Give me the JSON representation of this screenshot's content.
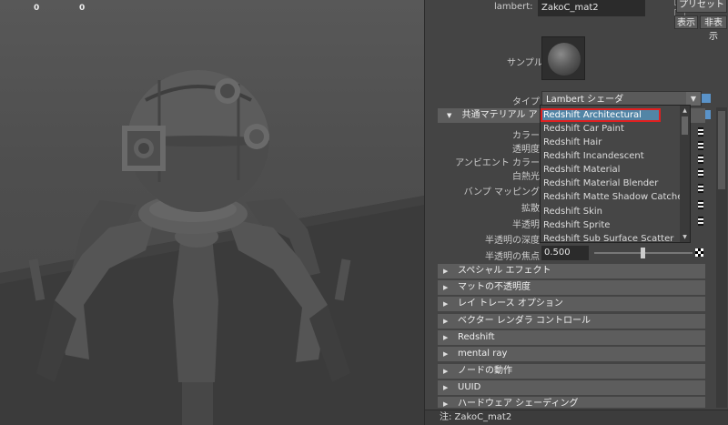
{
  "viewport": {
    "hud_left": "0",
    "hud_right": "0"
  },
  "panel": {
    "material_label": "lambert:",
    "material_name": "ZakoC_mat2",
    "preset_button": "プリセット",
    "show_button": "表示",
    "hide_button": "非表示",
    "sample_label": "サンプル",
    "type_label": "タイプ",
    "type_value": "Lambert シェーダ",
    "common_header": "共通マテリアル アトリビ",
    "attributes": [
      "カラー",
      "透明度",
      "アンビエント カラー",
      "白熱光",
      "バンプ マッピング",
      "拡散",
      "半透明",
      "半透明の深度",
      "半透明の焦点"
    ],
    "translucence_focus_value": "0.500",
    "sections": [
      "スペシャル エフェクト",
      "マットの不透明度",
      "レイ トレース オプション",
      "ベクター レンダラ コントロール",
      "Redshift",
      "mental ray",
      "ノードの動作",
      "UUID",
      "ハードウェア シェーディング"
    ],
    "footer": "注:  ZakoC_mat2"
  },
  "popup": {
    "items": [
      "Redshift Architectural",
      "Redshift Car Paint",
      "Redshift Hair",
      "Redshift Incandescent",
      "Redshift Material",
      "Redshift Material Blender",
      "Redshift Matte Shadow Catcher",
      "Redshift Skin",
      "Redshift Sprite",
      "Redshift Sub Surface Scatter"
    ],
    "selected_index": 0
  },
  "colors": {
    "selection": "#5285a6",
    "highlight_outline": "#e02020"
  }
}
